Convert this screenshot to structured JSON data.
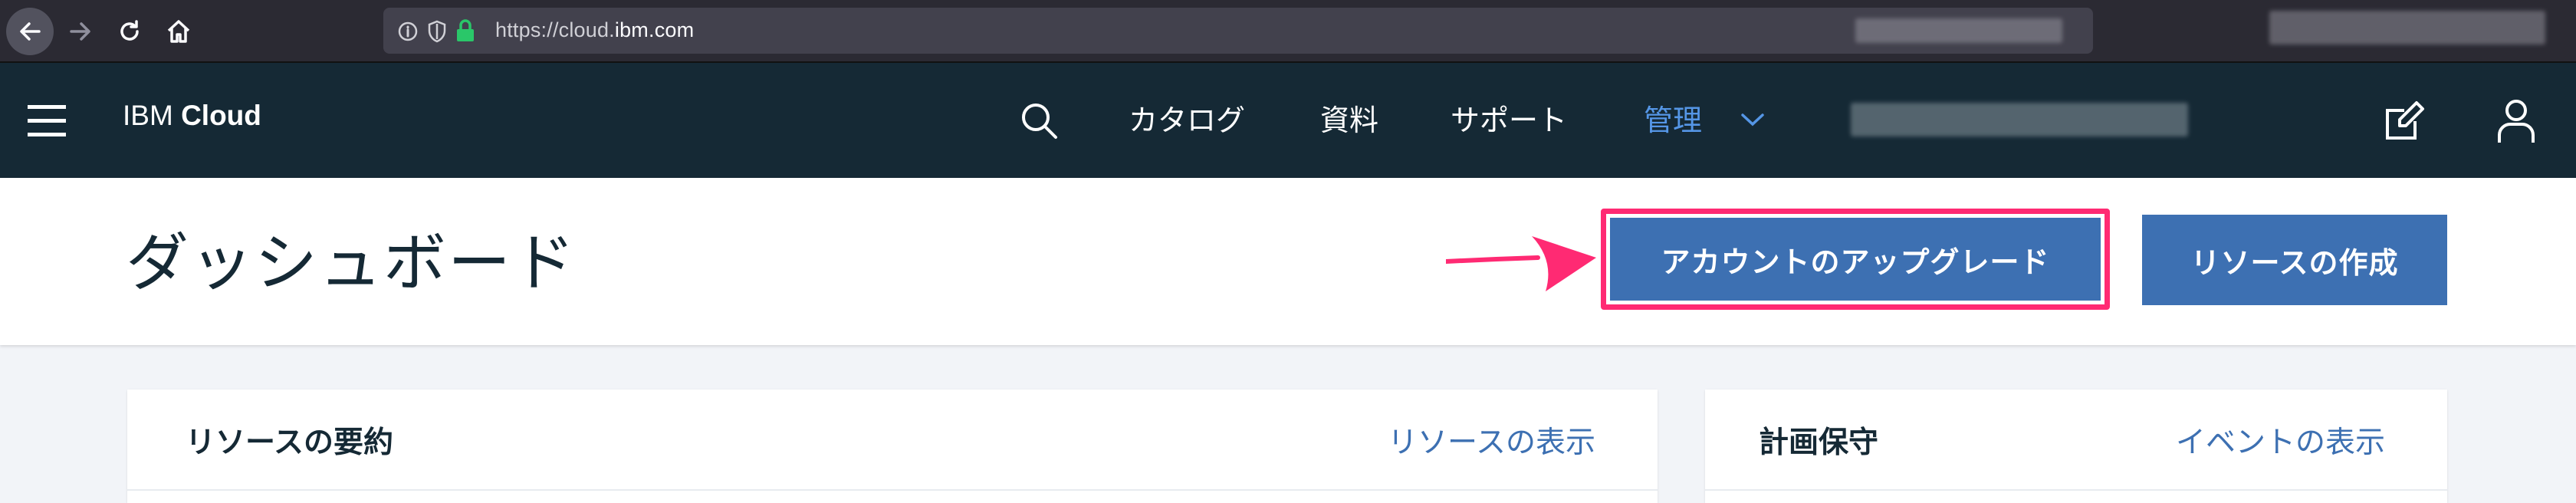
{
  "browser": {
    "url_prefix": "https://cloud.",
    "url_host": "ibm.com",
    "icons": [
      "back-arrow-icon",
      "forward-arrow-icon",
      "reload-icon",
      "home-icon",
      "info-icon",
      "shield-icon",
      "lock-icon"
    ]
  },
  "header": {
    "brand_prefix": "IBM",
    "brand_name": "Cloud",
    "nav": [
      "カタログ",
      "資料",
      "サポート",
      "管理"
    ],
    "colors": {
      "background": "#152935",
      "active_link": "#5596e6"
    }
  },
  "page": {
    "title": "ダッシュボード",
    "upgrade_button": "アカウントのアップグレード",
    "create_button": "リソースの作成",
    "colors": {
      "primary_button": "#3d70b2",
      "highlight": "#ff2a73"
    }
  },
  "cards": [
    {
      "title": "リソースの要約",
      "link": "リソースの表示"
    },
    {
      "title": "計画保守",
      "link": "イベントの表示"
    }
  ]
}
